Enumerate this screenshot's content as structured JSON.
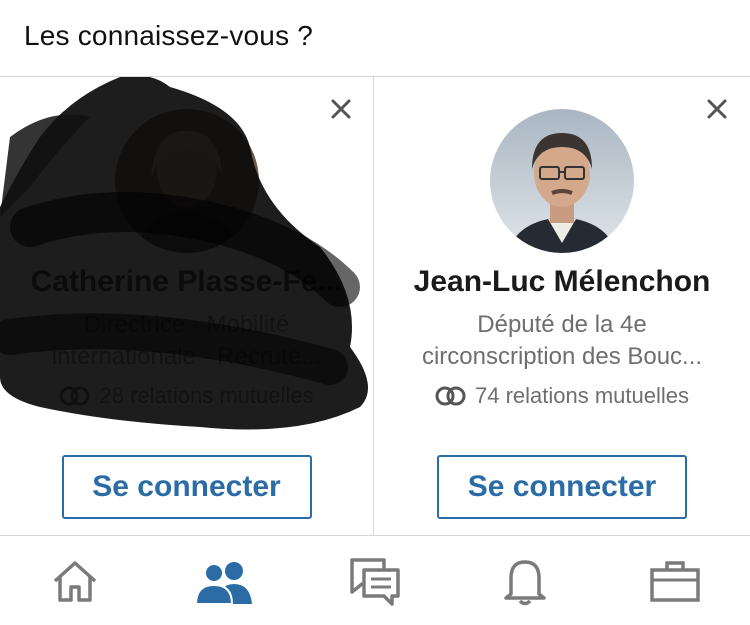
{
  "section": {
    "title": "Les connaissez-vous ?"
  },
  "cards": [
    {
      "name": "Catherine Plasse-Fe...",
      "headline_line1": "Directrice - Mobilité",
      "headline_line2": "internationale - Recrute...",
      "mutual": "28 relations mutuelles",
      "connect_label": "Se connecter",
      "redacted": true
    },
    {
      "name": "Jean-Luc Mélenchon",
      "headline_line1": "Député de la 4e",
      "headline_line2": "circonscription des Bouc...",
      "mutual": "74 relations mutuelles",
      "connect_label": "Se connecter",
      "redacted": false
    }
  ],
  "tabs": [
    {
      "icon": "home-icon",
      "active": false
    },
    {
      "icon": "network-icon",
      "active": true
    },
    {
      "icon": "messaging-icon",
      "active": false
    },
    {
      "icon": "notifications-icon",
      "active": false
    },
    {
      "icon": "jobs-icon",
      "active": false
    }
  ],
  "colors": {
    "accent": "#2b6ca6",
    "icon_gray": "#7a7a7a",
    "border": "#d6d6d6"
  }
}
